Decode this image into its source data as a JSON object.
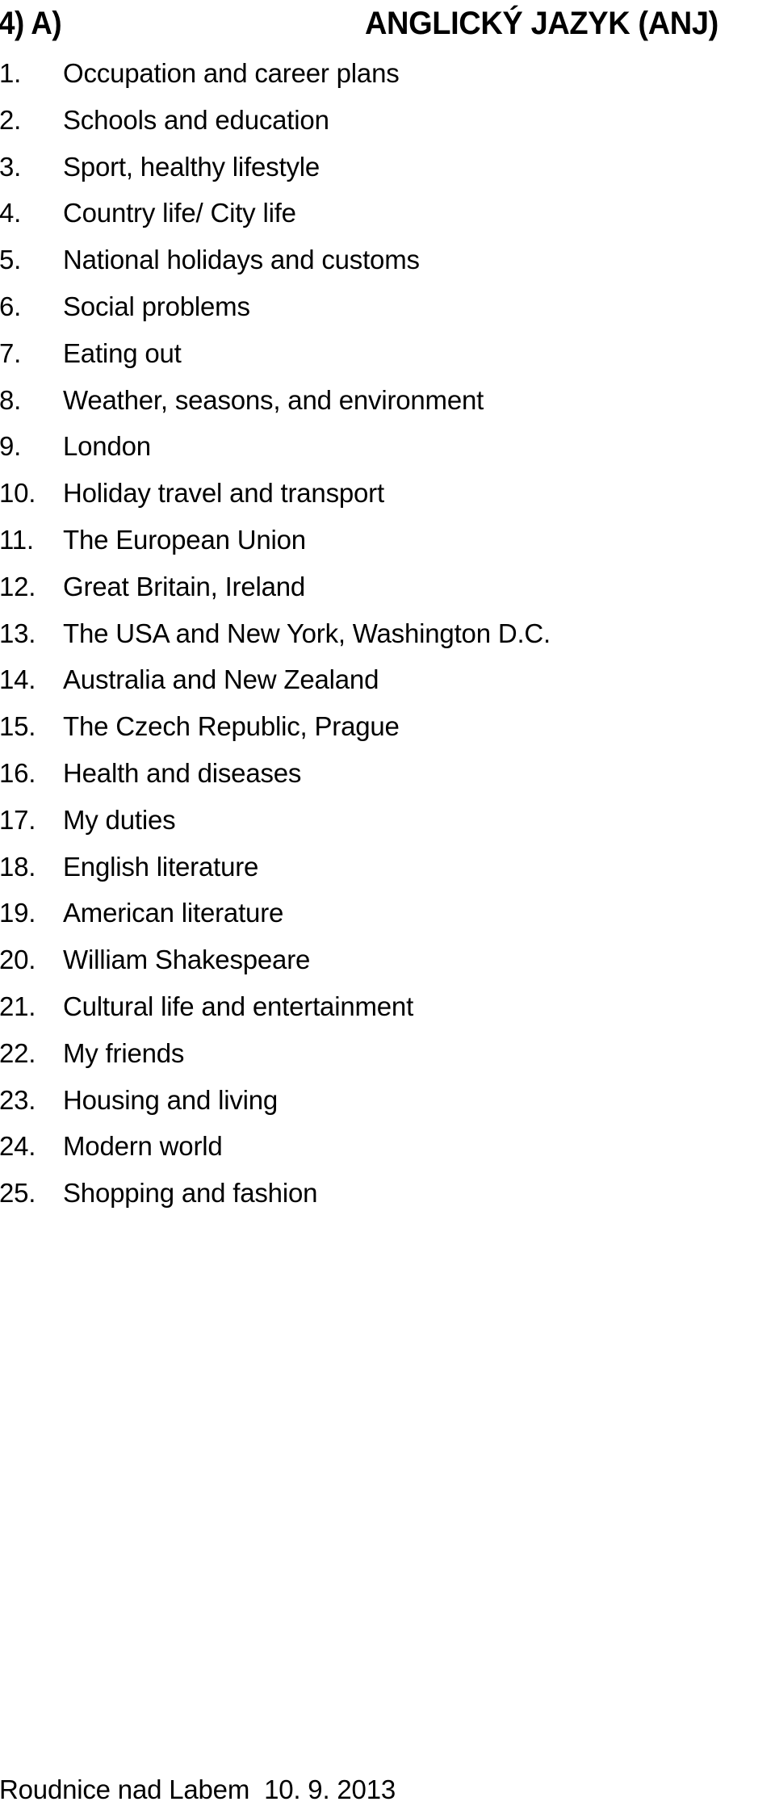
{
  "document": {
    "header": {
      "code_label": "4) A)",
      "subject_title": "ANGLICKÝ JAZYK (ANJ)"
    },
    "topics": [
      {
        "number": "1.",
        "label": "Occupation and career plans"
      },
      {
        "number": "2.",
        "label": "Schools and education"
      },
      {
        "number": "3.",
        "label": "Sport, healthy lifestyle"
      },
      {
        "number": "4.",
        "label": "Country life/ City life"
      },
      {
        "number": "5.",
        "label": "National holidays and customs"
      },
      {
        "number": "6.",
        "label": "Social problems"
      },
      {
        "number": "7.",
        "label": "Eating out"
      },
      {
        "number": "8.",
        "label": "Weather, seasons, and environment"
      },
      {
        "number": "9.",
        "label": "London"
      },
      {
        "number": "10.",
        "label": "Holiday travel and transport"
      },
      {
        "number": "11.",
        "label": "The European Union"
      },
      {
        "number": "12.",
        "label": "Great Britain, Ireland"
      },
      {
        "number": "13.",
        "label": "The USA and New York, Washington D.C."
      },
      {
        "number": "14.",
        "label": "Australia and New Zealand"
      },
      {
        "number": "15.",
        "label": "The Czech Republic, Prague"
      },
      {
        "number": "16.",
        "label": "Health and diseases"
      },
      {
        "number": "17.",
        "label": "My duties"
      },
      {
        "number": "18.",
        "label": "English literature"
      },
      {
        "number": "19.",
        "label": "American literature"
      },
      {
        "number": "20.",
        "label": "William Shakespeare"
      },
      {
        "number": "21.",
        "label": "Cultural life and entertainment"
      },
      {
        "number": "22.",
        "label": "My friends"
      },
      {
        "number": "23.",
        "label": "Housing and living"
      },
      {
        "number": "24.",
        "label": "Modern world"
      },
      {
        "number": "25.",
        "label": "Shopping and fashion"
      }
    ],
    "footer": {
      "place_and_date": "Roudnice nad Labem  10. 9. 2013"
    }
  }
}
